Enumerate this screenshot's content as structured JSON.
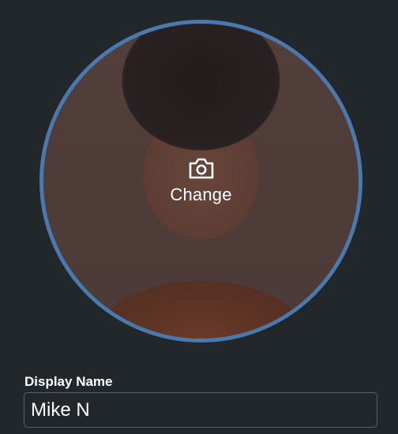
{
  "avatar": {
    "change_label": "Change",
    "camera_icon": "camera-icon",
    "ring_color": "#4a79ae"
  },
  "display_name": {
    "label": "Display Name",
    "value": "Mike N"
  },
  "colors": {
    "background": "#22272c",
    "text": "#ffffff"
  }
}
